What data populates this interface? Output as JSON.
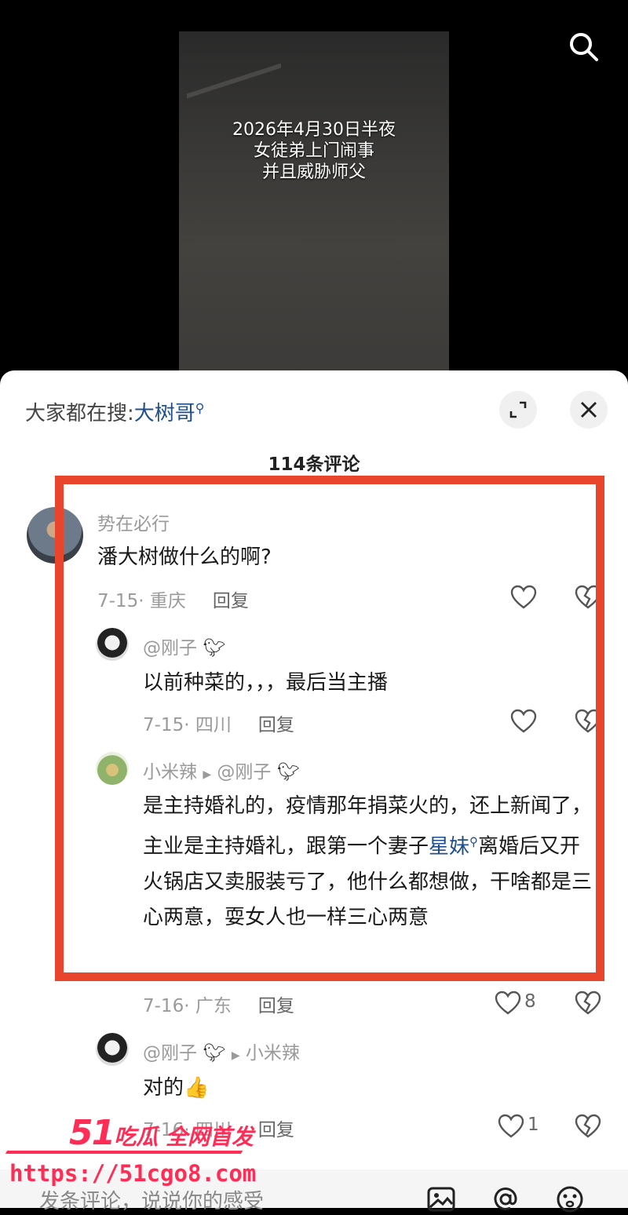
{
  "video": {
    "caption": "2026年4月30日半夜\n女徒弟上门闹事\n并且威胁师父"
  },
  "header": {
    "hot_search_prefix": "大家都在搜:",
    "hot_search_keyword": "大树哥",
    "comment_count": "114条评论"
  },
  "comments": [
    {
      "username": "势在必行",
      "text": "潘大树做什么的啊?",
      "date_location": "7-15· 重庆",
      "reply_label": "回复",
      "likes": ""
    },
    {
      "username": "@刚子",
      "text": "以前种菜的，，，最后当主播",
      "date_location": "7-15· 四川",
      "reply_label": "回复",
      "likes": ""
    },
    {
      "username": "小米辣",
      "reply_to": "@刚子",
      "text_part1": "是主持婚礼的，疫情那年捐菜火的，还上新闻了，主业是主持婚礼，跟第一个妻子",
      "link": "星妹",
      "text_part2": "离婚后又开火锅店又卖服装亏了，他什么都想做，干啥都是三心两意，耍女人也一样三心两意",
      "date_location": "7-16· 广东",
      "reply_label": "回复",
      "likes": "8"
    },
    {
      "username": "@刚子",
      "reply_to": "小米辣",
      "text": "对的",
      "date_location": "7-16· 四川",
      "reply_label": "回复",
      "likes": "1"
    }
  ],
  "input": {
    "placeholder": "发条评论，说说你的感受"
  },
  "watermark": {
    "number": "51",
    "slogan": "吃瓜 全网首发",
    "url": "https://51cgo8.com"
  },
  "colors": {
    "highlight_box": "#e8452c",
    "link": "#1f4e8c",
    "watermark": "#ff2d55"
  }
}
